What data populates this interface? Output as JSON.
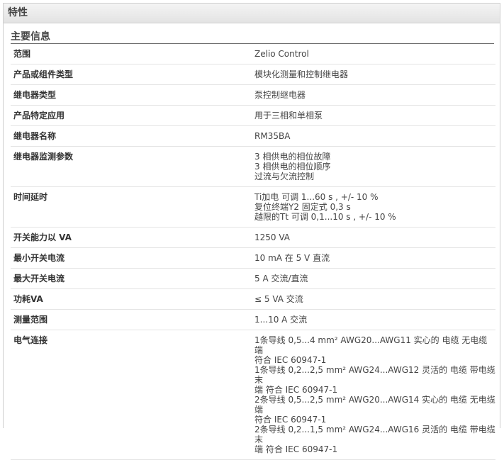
{
  "panel": {
    "title": "特性"
  },
  "section": {
    "title": "主要信息"
  },
  "rows": [
    {
      "label": "范围",
      "values": [
        "Zelio Control"
      ]
    },
    {
      "label": "产品或组件类型",
      "values": [
        "模块化测量和控制继电器"
      ]
    },
    {
      "label": "继电器类型",
      "values": [
        "泵控制继电器"
      ]
    },
    {
      "label": "产品特定应用",
      "values": [
        "用于三相和单相泵"
      ]
    },
    {
      "label": "继电器名称",
      "values": [
        "RM35BA"
      ]
    },
    {
      "label": "继电器监测参数",
      "values": [
        "3 相供电的相位故障",
        "3 相供电的相位顺序",
        "过流与欠流控制"
      ]
    },
    {
      "label": "时间延时",
      "values": [
        "Ti加电 可调 1...60 s , +/- 10 %",
        "复位终端Y2 固定式 0,3 s",
        "越限的Tt 可调 0,1...10 s , +/- 10 %"
      ]
    },
    {
      "label": "开关能力以 VA",
      "values": [
        "1250 VA"
      ]
    },
    {
      "label": "最小开关电流",
      "values": [
        "10 mA 在 5 V 直流"
      ]
    },
    {
      "label": "最大开关电流",
      "values": [
        "5 A 交流/直流"
      ]
    },
    {
      "label": "功耗VA",
      "values": [
        "≤ 5 VA 交流"
      ]
    },
    {
      "label": "测量范围",
      "values": [
        "1...10 A 交流"
      ]
    },
    {
      "label": "电气连接",
      "values": [
        "1条导线 0,5...4 mm² AWG20...AWG11 实心的 电缆 无电缆端",
        "符合 IEC 60947-1",
        "1条导线 0,2...2,5 mm² AWG24...AWG12 灵活的 电缆 带电缆末",
        "端 符合 IEC 60947-1",
        "2条导线 0,5...2,5 mm² AWG20...AWG14 实心的 电缆 无电缆端",
        "符合 IEC 60947-1",
        "2条导线 0,2...1,5 mm² AWG24...AWG16 灵活的 电缆 带电缆末",
        "端 符合 IEC 60947-1"
      ]
    }
  ]
}
